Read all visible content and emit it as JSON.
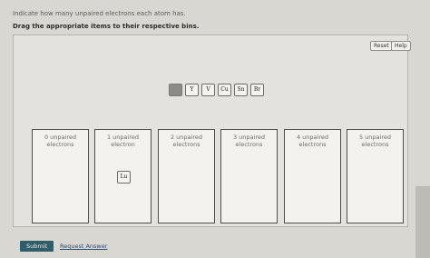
{
  "prompt": "Indicate how many unpaired electrons each atom has.",
  "instruction": "Drag the appropriate items to their respective bins.",
  "controls": {
    "reset": "Reset",
    "help": "Help"
  },
  "tiles": [
    "Y",
    "V",
    "Cu",
    "Sn",
    "Br"
  ],
  "bins": [
    {
      "line1": "0 unpaired",
      "line2": "electrons"
    },
    {
      "line1": "1 unpaired",
      "line2": "electron",
      "tile": "Lu"
    },
    {
      "line1": "2 unpaired",
      "line2": "electrons"
    },
    {
      "line1": "3 unpaired",
      "line2": "electrons"
    },
    {
      "line1": "4 unpaired",
      "line2": "electrons"
    },
    {
      "line1": "5 unpaired",
      "line2": "electrons"
    }
  ],
  "footer": {
    "submit": "Submit",
    "request_answer": "Request Answer"
  }
}
